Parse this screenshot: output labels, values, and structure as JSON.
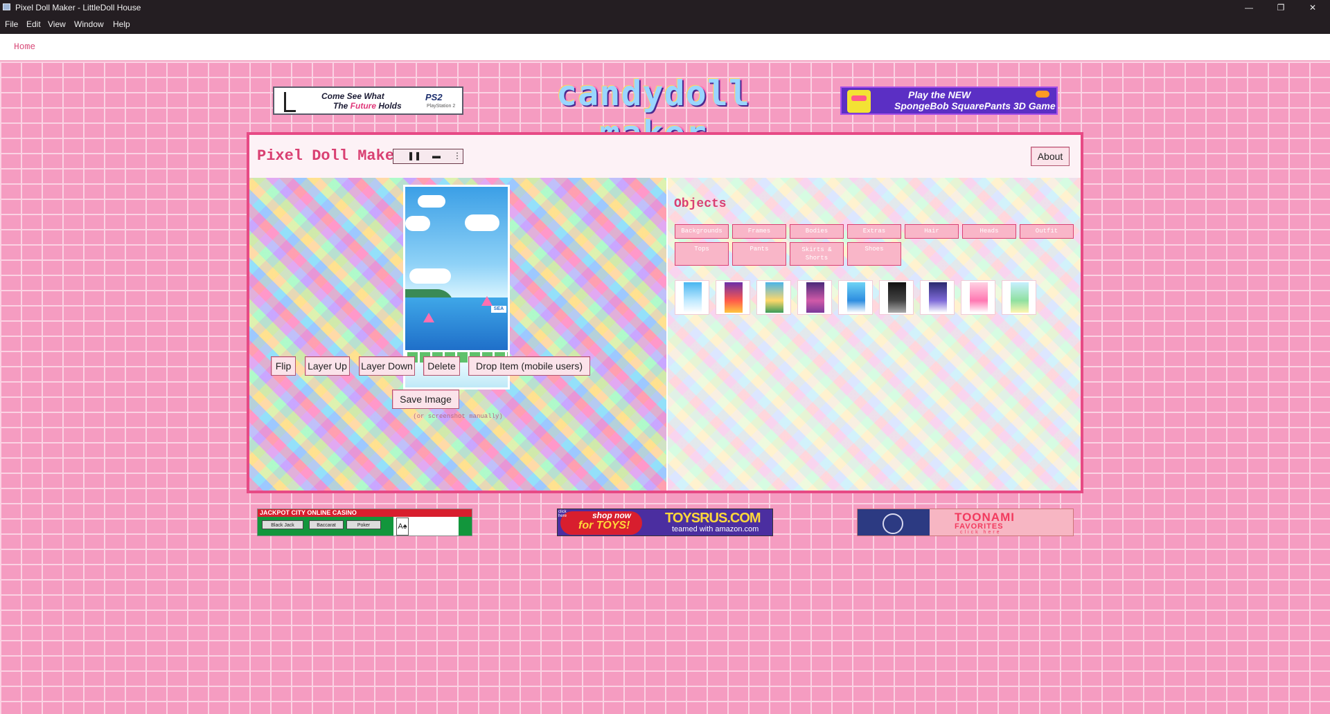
{
  "window": {
    "title": "Pixel Doll Maker - LittleDoll House",
    "minimize": "—",
    "restore": "❐",
    "close": "✕"
  },
  "menu": {
    "file": "File",
    "edit": "Edit",
    "view": "View",
    "window": "Window",
    "help": "Help"
  },
  "nav": {
    "home": "Home"
  },
  "top_banners": {
    "ps2": {
      "line1": "Come See What",
      "line2_prefix": "The ",
      "line2_highlight": "Future",
      "line2_suffix": " Holds",
      "logo": "PS2",
      "logo_sub": "PlayStation 2"
    },
    "site_logo": "candydoll maker",
    "spongebob": {
      "line1": "Play the NEW",
      "line2": "SpongeBob SquarePants 3D Game"
    }
  },
  "panel": {
    "title": "Pixel Doll Maker",
    "media": {
      "pause": "❚❚",
      "minimize": "▬",
      "more": "⋮"
    },
    "about": "About"
  },
  "canvas": {
    "sign_text": "SEA",
    "buttons": {
      "flip": "Flip",
      "layer_up": "Layer Up",
      "layer_down": "Layer Down",
      "delete": "Delete",
      "drop_item": "Drop Item (mobile users)",
      "save_image": "Save Image"
    },
    "save_hint": "(or screenshot manually)"
  },
  "objects": {
    "title": "Objects",
    "categories": [
      "Backgrounds",
      "Frames",
      "Bodies",
      "Extras",
      "Hair",
      "Heads",
      "Outfit",
      "Tops",
      "Pants",
      "Skirts & Shorts",
      "Shoes"
    ],
    "thumbnail_palettes": [
      [
        "#4ab6f0",
        "#bfe9ff",
        "#ffffff"
      ],
      [
        "#6b2fa8",
        "#ff5a4a",
        "#ffc640"
      ],
      [
        "#4bb4e8",
        "#ffd86a",
        "#3a9b5a"
      ],
      [
        "#4a2a7a",
        "#d05aa8",
        "#7a3a9a"
      ],
      [
        "#6fd3f5",
        "#2d8de0",
        "#ffffff"
      ],
      [
        "#111111",
        "#444444",
        "#aaaaaa"
      ],
      [
        "#2b2a6e",
        "#7e6ad8",
        "#ffffff"
      ],
      [
        "#ffd1e3",
        "#ff78b2",
        "#ffffff"
      ],
      [
        "#c7f0ff",
        "#8fe0a0",
        "#fff6b0"
      ]
    ]
  },
  "bottom_banners": {
    "casino": {
      "title": "JACKPOT CITY ONLINE CASINO",
      "btn1": "Black Jack",
      "btn2": "Baccarat",
      "btn3": "Poker",
      "card": "A♠"
    },
    "toysrus": {
      "shop": "shop now",
      "for": "for TOYS!",
      "brand": "TOYSRUS.COM",
      "amazon": "teamed with amazon.com",
      "tiny": "click here"
    },
    "toonami": {
      "line1": "TOONAMI",
      "line2": "FAVORITES",
      "line3": "click here"
    }
  }
}
